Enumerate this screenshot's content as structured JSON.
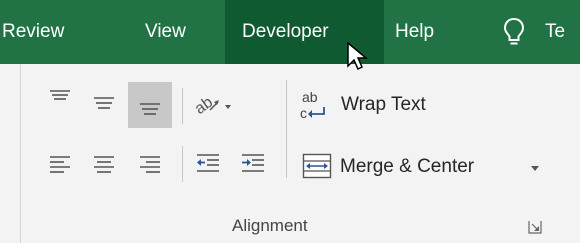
{
  "ribbon_tabs": {
    "review": "Review",
    "view": "View",
    "developer": "Developer",
    "help": "Help",
    "tell_me": "Te"
  },
  "alignment_group": {
    "wrap_text_label": "Wrap Text",
    "merge_center_label": "Merge & Center",
    "group_label": "Alignment"
  },
  "colors": {
    "ribbon_green": "#217346",
    "active_tab": "#0f5a31",
    "ribbon_body": "#f3f3f3",
    "pressed_button": "#c8c8c8",
    "blue_accent": "#2b579a"
  }
}
